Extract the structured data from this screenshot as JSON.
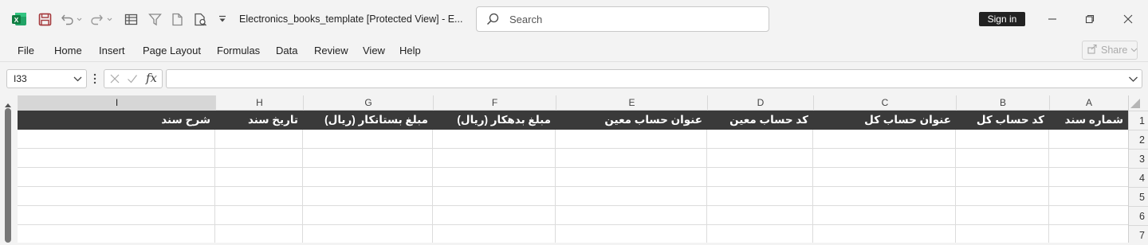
{
  "titlebar": {
    "document_title": "Electronics_books_template  [Protected View]  -  E...",
    "search_placeholder": "Search",
    "signin_label": "Sign in",
    "icons": [
      "excel-logo",
      "save-icon",
      "undo-icon",
      "redo-icon",
      "form-icon",
      "filter-icon",
      "new-doc-icon",
      "print-preview-icon",
      "customize-dropdown-icon"
    ]
  },
  "menu": {
    "items": [
      "File",
      "Home",
      "Insert",
      "Page Layout",
      "Formulas",
      "Data",
      "Review",
      "View",
      "Help"
    ],
    "share_label": "Share"
  },
  "formula_bar": {
    "name_box": "I33",
    "fx_label": "fx",
    "formula_value": ""
  },
  "sheet": {
    "columns": [
      "I",
      "H",
      "G",
      "F",
      "E",
      "D",
      "C",
      "B",
      "A"
    ],
    "selected_column": "I",
    "rows": [
      "1",
      "2",
      "3",
      "4",
      "5",
      "6",
      "7"
    ],
    "header_row": {
      "A": "شماره سند",
      "B": "کد حساب کل",
      "C": "عنوان حساب کل",
      "D": "کد حساب معین",
      "E": "عنوان حساب معین",
      "F": "مبلغ بدهکار (ریال)",
      "G": "مبلغ بستانکار (ریال)",
      "H": "تاریخ سند",
      "I": "شرح سند"
    },
    "header_bg": "#3a3a3a",
    "header_fg": "#ffffff"
  }
}
